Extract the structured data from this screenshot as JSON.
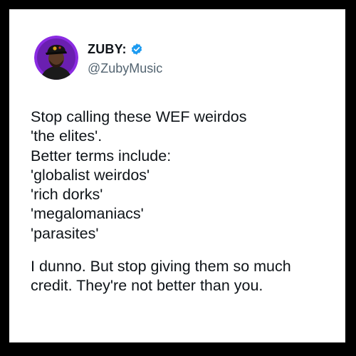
{
  "author": {
    "display_name": "ZUBY:",
    "handle": "@ZubyMusic",
    "verified": true,
    "avatar_icon": "profile-photo-man-in-cap",
    "avatar_ring_color": "#8b2be2"
  },
  "tweet": {
    "lines": [
      "Stop calling these WEF weirdos",
      "'the elites'.",
      "Better terms include:",
      "'globalist weirdos'",
      "'rich dorks'",
      "'megalomaniacs'",
      "'parasites'"
    ],
    "closing_lines": [
      "I dunno. But stop giving them so much",
      "credit.  They're not better than you."
    ]
  },
  "colors": {
    "border": "#000000",
    "background": "#ffffff",
    "verified_badge": "#1d9bf0",
    "handle_text": "#536471"
  }
}
